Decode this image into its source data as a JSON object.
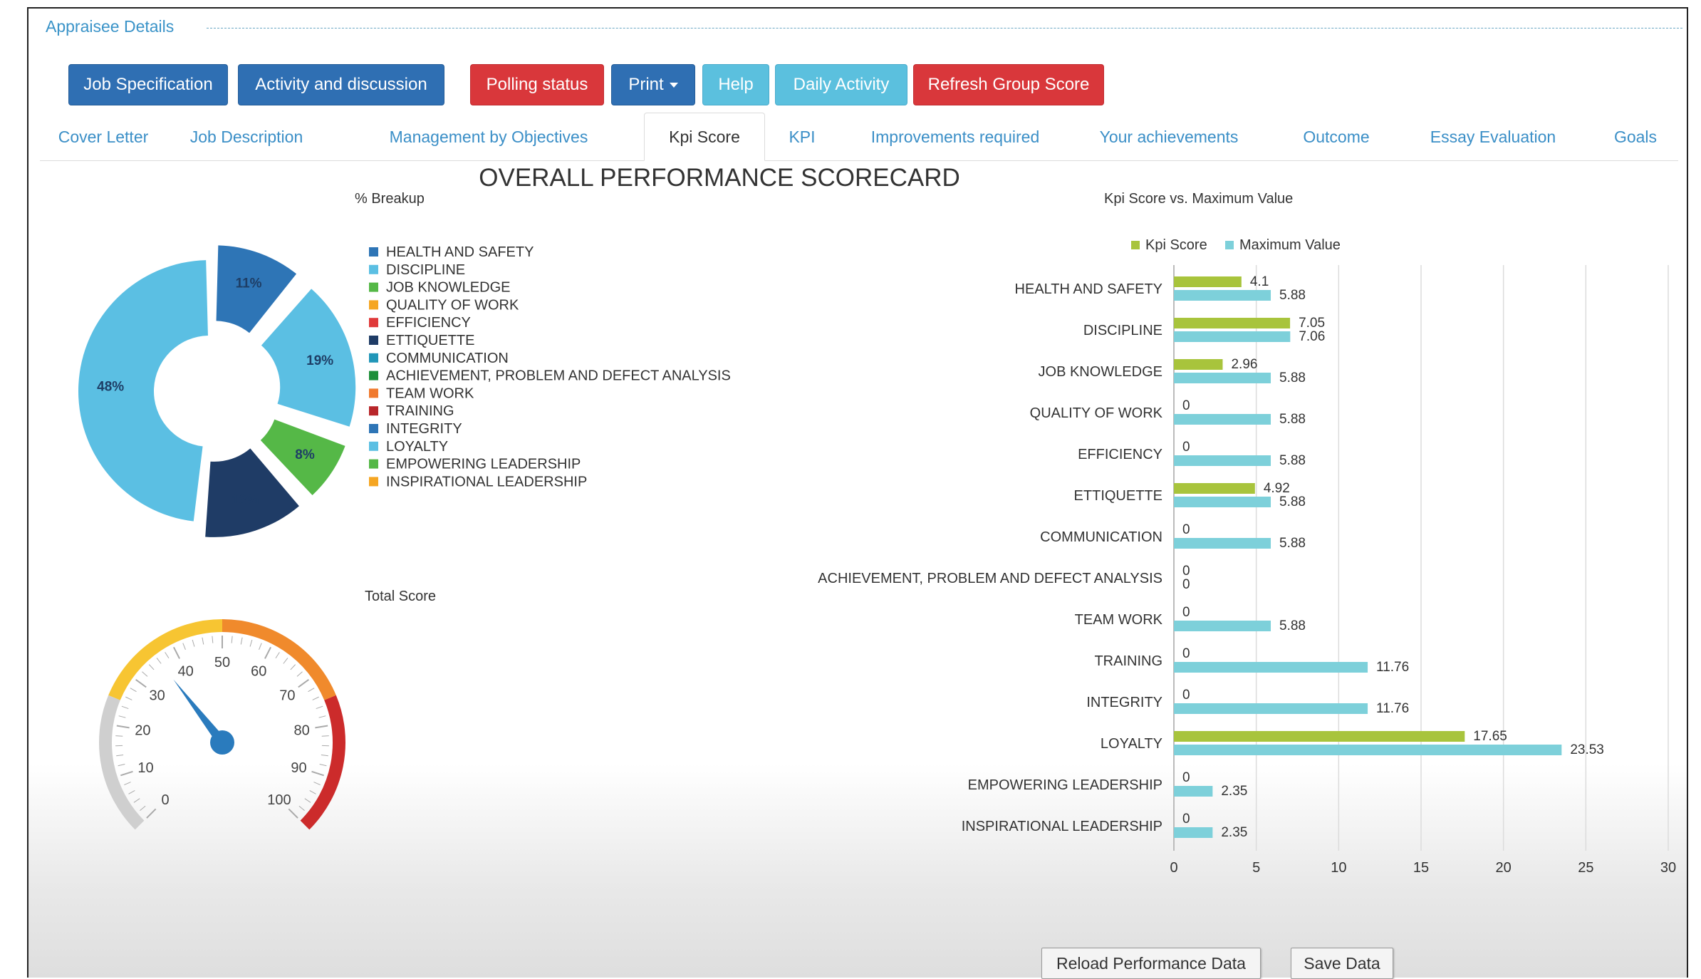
{
  "fieldset": {
    "legend": "Appraisee Details"
  },
  "buttons": {
    "job_specification": "Job Specification",
    "activity_discussion": "Activity and discussion",
    "polling_status": "Polling status",
    "print": "Print",
    "help": "Help",
    "daily_activity": "Daily Activity",
    "refresh_group_score": "Refresh Group Score"
  },
  "tabs": [
    "Cover Letter",
    "Job Description",
    "Management by Objectives",
    "Kpi Score",
    "KPI",
    "Improvements required",
    "Your achievements",
    "Outcome",
    "Essay Evaluation",
    "Goals"
  ],
  "active_tab": "Kpi Score",
  "page_title": "OVERALL PERFORMANCE SCORECARD",
  "footer": {
    "reload": "Reload Performance Data",
    "save": "Save Data"
  },
  "colors": {
    "btn_blue": "#2f6fb3",
    "btn_red": "#d9373b",
    "btn_light": "#5bc0de",
    "kpi_score": "#a8c43c",
    "max_value": "#7dd0da"
  },
  "chart_data": [
    {
      "type": "pie",
      "title": "% Breakup",
      "legend": [
        {
          "name": "HEALTH AND SAFETY",
          "color": "#2e75b6"
        },
        {
          "name": "DISCIPLINE",
          "color": "#5bbfe3"
        },
        {
          "name": "JOB KNOWLEDGE",
          "color": "#55b847"
        },
        {
          "name": "QUALITY OF WORK",
          "color": "#f5a623"
        },
        {
          "name": "EFFICIENCY",
          "color": "#e03a3a"
        },
        {
          "name": "ETTIQUETTE",
          "color": "#1f3c66"
        },
        {
          "name": "COMMUNICATION",
          "color": "#2196b8"
        },
        {
          "name": "ACHIEVEMENT, PROBLEM AND DEFECT ANALYSIS",
          "color": "#1e8f3a"
        },
        {
          "name": "TEAM WORK",
          "color": "#f07a2e"
        },
        {
          "name": "TRAINING",
          "color": "#b8262a"
        },
        {
          "name": "INTEGRITY",
          "color": "#2e75b6"
        },
        {
          "name": "LOYALTY",
          "color": "#5bbfe3"
        },
        {
          "name": "EMPOWERING LEADERSHIP",
          "color": "#55b847"
        },
        {
          "name": "INSPIRATIONAL LEADERSHIP",
          "color": "#f5a623"
        }
      ],
      "slices": [
        {
          "label": "11%",
          "value": 11,
          "color": "#2e75b6",
          "text_color": "#1e3e66"
        },
        {
          "label": "19%",
          "value": 19,
          "color": "#5bbfe3",
          "text_color": "#1e3e66"
        },
        {
          "label": "8%",
          "value": 8,
          "color": "#55b847",
          "text_color": "#1e3e66"
        },
        {
          "label": "13%",
          "value": 13,
          "color": "#1f3c66",
          "text_color": "#1f3c66"
        },
        {
          "label": "48%",
          "value": 48,
          "color": "#5bbfe3",
          "text_color": "#1e3e66"
        }
      ]
    },
    {
      "type": "gauge",
      "title": "Total Score",
      "min": 0,
      "max": 100,
      "value": 36,
      "ticks": [
        "0",
        "10",
        "20",
        "30",
        "40",
        "50",
        "60",
        "70",
        "80",
        "90",
        "100"
      ],
      "bands": [
        {
          "from": 0,
          "to": 25,
          "color": "#cfcfcf"
        },
        {
          "from": 25,
          "to": 50,
          "color": "#f7c532"
        },
        {
          "from": 50,
          "to": 75,
          "color": "#f08a2c"
        },
        {
          "from": 75,
          "to": 100,
          "color": "#cc2b2b"
        }
      ]
    },
    {
      "type": "bar",
      "orientation": "horizontal",
      "title": "Kpi Score vs. Maximum Value",
      "categories": [
        "HEALTH AND SAFETY",
        "DISCIPLINE",
        "JOB KNOWLEDGE",
        "QUALITY OF WORK",
        "EFFICIENCY",
        "ETTIQUETTE",
        "COMMUNICATION",
        "ACHIEVEMENT, PROBLEM AND DEFECT ANALYSIS",
        "TEAM WORK",
        "TRAINING",
        "INTEGRITY",
        "LOYALTY",
        "EMPOWERING LEADERSHIP",
        "INSPIRATIONAL LEADERSHIP"
      ],
      "series": [
        {
          "name": "Kpi Score",
          "color": "#a8c43c",
          "values": [
            4.1,
            7.05,
            2.96,
            0,
            0,
            4.92,
            0,
            0,
            0,
            0,
            0,
            17.65,
            0,
            0
          ]
        },
        {
          "name": "Maximum Value",
          "color": "#7dd0da",
          "values": [
            5.88,
            7.06,
            5.88,
            5.88,
            5.88,
            5.88,
            5.88,
            0,
            5.88,
            11.76,
            11.76,
            23.53,
            2.35,
            2.35
          ]
        }
      ],
      "xlim": [
        0,
        30
      ],
      "xticks": [
        0,
        5,
        10,
        15,
        20,
        25,
        30
      ],
      "legend_position": "top",
      "grid": true
    }
  ]
}
